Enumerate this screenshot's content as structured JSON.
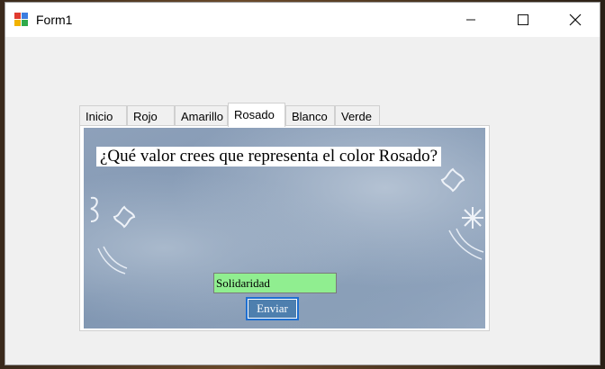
{
  "window": {
    "title": "Form1",
    "icon": "winforms-app-icon",
    "controls": {
      "minimize": "minimize-icon",
      "maximize": "maximize-icon",
      "close": "close-icon"
    }
  },
  "tabs": [
    {
      "label": "Inicio",
      "active": false
    },
    {
      "label": "Rojo",
      "active": false
    },
    {
      "label": "Amarillo",
      "active": false
    },
    {
      "label": "Rosado",
      "active": true
    },
    {
      "label": "Blanco",
      "active": false
    },
    {
      "label": "Verde",
      "active": false
    }
  ],
  "panel": {
    "question": "¿Qué valor crees que representa el color Rosado?",
    "answer_value": "Solidaridad",
    "submit_label": "Enviar"
  },
  "colors": {
    "answer_field_bg": "#90ee90",
    "submit_bg": "#4e7fae",
    "submit_border": "#1e6fd0"
  }
}
